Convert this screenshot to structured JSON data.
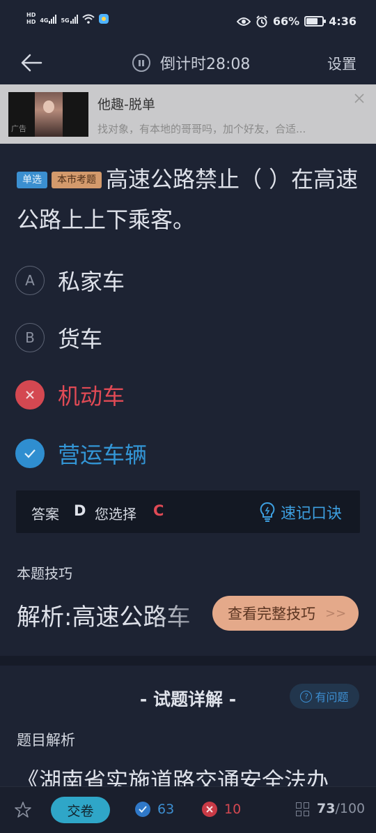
{
  "status_bar": {
    "hd1": "HD",
    "hd2": "HD",
    "net1": "4G",
    "net2": "5G",
    "battery_pct": "66%",
    "battery_level": 0.66,
    "time": "4:36"
  },
  "header": {
    "timer_label": "倒计时28:08",
    "settings_label": "设置"
  },
  "ad": {
    "title": "他趣-脱单",
    "description": "找对象，有本地的哥哥吗，加个好友，合适...",
    "tag": "广告"
  },
  "question": {
    "type_tag": "单选",
    "source_tag": "本市考题",
    "text": "高速公路禁止（ ）在高速公路上上下乘客。",
    "options": [
      {
        "letter": "A",
        "text": "私家车",
        "state": "normal"
      },
      {
        "letter": "B",
        "text": "货车",
        "state": "normal"
      },
      {
        "letter": "C",
        "text": "机动车",
        "state": "wrong"
      },
      {
        "letter": "D",
        "text": "营运车辆",
        "state": "correct"
      }
    ]
  },
  "answer": {
    "answer_label": "答案",
    "answer_value": "D",
    "chosen_label": "您选择",
    "chosen_value": "C",
    "memo_label": "速记口诀"
  },
  "tips": {
    "title": "本题技巧",
    "text": "解析:高速公路车",
    "button_label": "查看完整技巧"
  },
  "detail": {
    "title": "- 试题详解 -",
    "issue_label": "有问题",
    "analysis_title": "题目解析",
    "analysis_text": "《湖南省实施道路交通安全法办"
  },
  "bottom": {
    "submit_label": "交卷",
    "correct_count": "63",
    "wrong_count": "10",
    "progress_current": "73",
    "progress_total": "/100"
  },
  "colors": {
    "background": "#1d2333",
    "correct": "#2f8ed0",
    "wrong": "#d44851",
    "accent_tip": "#e4a98a"
  }
}
